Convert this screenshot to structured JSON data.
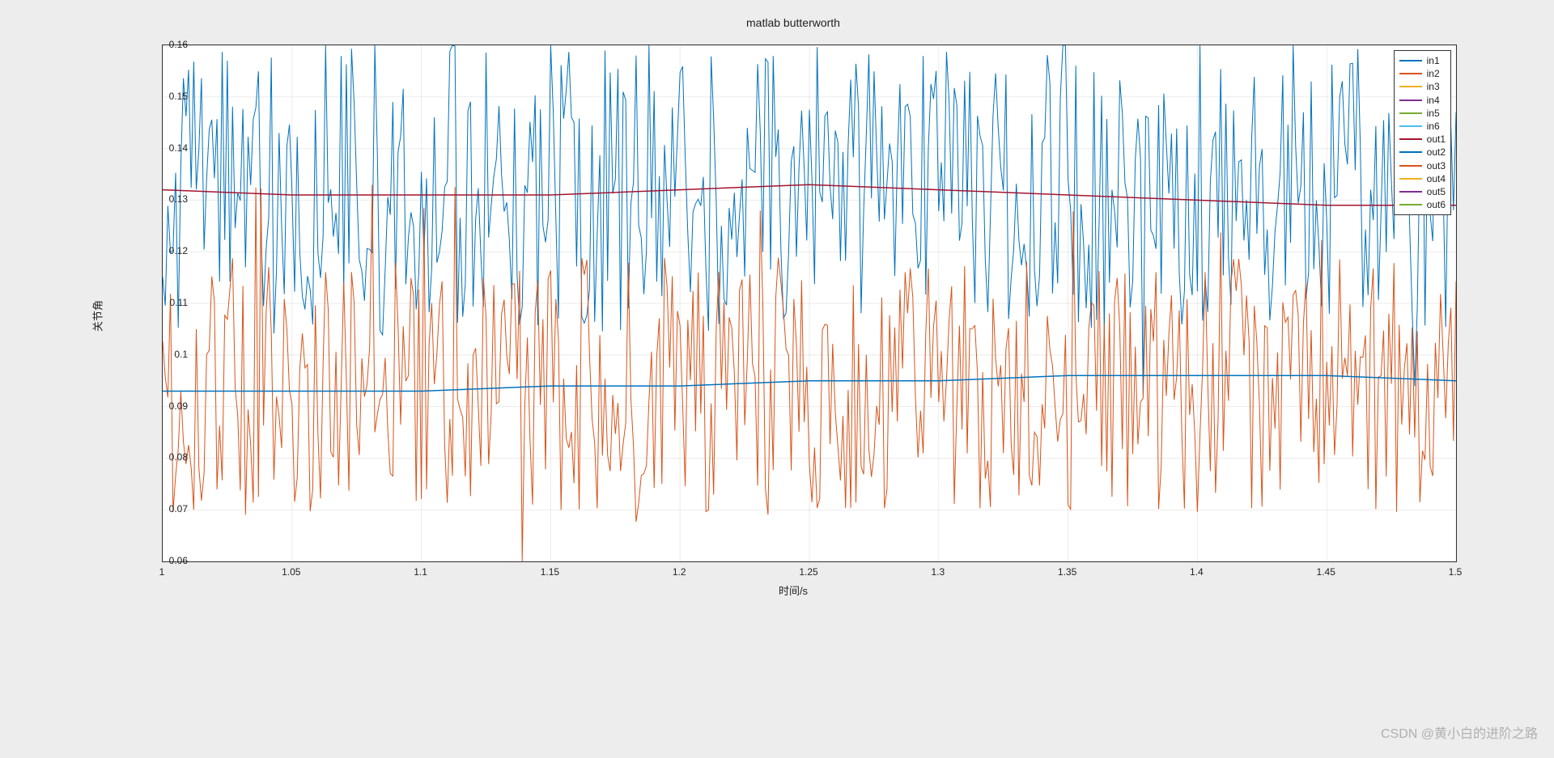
{
  "chart_data": {
    "type": "line",
    "title": "matlab butterworth",
    "xlabel": "时间/s",
    "ylabel": "关节角",
    "xlim": [
      1.0,
      1.5
    ],
    "ylim": [
      0.06,
      0.16
    ],
    "xticks": [
      1,
      1.05,
      1.1,
      1.15,
      1.2,
      1.25,
      1.3,
      1.35,
      1.4,
      1.45,
      1.5
    ],
    "yticks": [
      0.06,
      0.07,
      0.08,
      0.09,
      0.1,
      0.11,
      0.12,
      0.13,
      0.14,
      0.15,
      0.16
    ],
    "legend_position": "top-right",
    "series": [
      {
        "name": "in1",
        "color": "#0072BD",
        "kind": "noisy",
        "mean": 0.132,
        "band": 0.028,
        "note": "noisy input signal (blue)"
      },
      {
        "name": "in2",
        "color": "#D95319",
        "kind": "noisy",
        "mean": 0.094,
        "band": 0.025,
        "note": "noisy input signal (orange)"
      },
      {
        "name": "in3",
        "color": "#EDB120",
        "kind": "hidden-behind",
        "note": "obscured"
      },
      {
        "name": "in4",
        "color": "#7E2F8E",
        "kind": "hidden-behind",
        "note": "obscured"
      },
      {
        "name": "in5",
        "color": "#77AC30",
        "kind": "hidden-behind",
        "note": "obscured"
      },
      {
        "name": "in6",
        "color": "#4DBEEE",
        "kind": "hidden-behind",
        "note": "obscured"
      },
      {
        "name": "out1",
        "color": "#A2142F",
        "kind": "smooth",
        "values": [
          {
            "x": 1.0,
            "y": 0.132
          },
          {
            "x": 1.05,
            "y": 0.131
          },
          {
            "x": 1.1,
            "y": 0.131
          },
          {
            "x": 1.15,
            "y": 0.131
          },
          {
            "x": 1.2,
            "y": 0.132
          },
          {
            "x": 1.25,
            "y": 0.133
          },
          {
            "x": 1.3,
            "y": 0.132
          },
          {
            "x": 1.35,
            "y": 0.131
          },
          {
            "x": 1.4,
            "y": 0.13
          },
          {
            "x": 1.45,
            "y": 0.129
          },
          {
            "x": 1.5,
            "y": 0.129
          }
        ]
      },
      {
        "name": "out2",
        "color": "#0072BD",
        "kind": "smooth",
        "values": [
          {
            "x": 1.0,
            "y": 0.093
          },
          {
            "x": 1.05,
            "y": 0.093
          },
          {
            "x": 1.1,
            "y": 0.093
          },
          {
            "x": 1.15,
            "y": 0.094
          },
          {
            "x": 1.2,
            "y": 0.094
          },
          {
            "x": 1.25,
            "y": 0.095
          },
          {
            "x": 1.3,
            "y": 0.095
          },
          {
            "x": 1.35,
            "y": 0.096
          },
          {
            "x": 1.4,
            "y": 0.096
          },
          {
            "x": 1.45,
            "y": 0.096
          },
          {
            "x": 1.5,
            "y": 0.095
          }
        ]
      },
      {
        "name": "out3",
        "color": "#D95319",
        "kind": "hidden-behind"
      },
      {
        "name": "out4",
        "color": "#EDB120",
        "kind": "hidden-behind"
      },
      {
        "name": "out5",
        "color": "#7E2F8E",
        "kind": "hidden-behind"
      },
      {
        "name": "out6",
        "color": "#77AC30",
        "kind": "hidden-behind"
      }
    ],
    "legend": [
      "in1",
      "in2",
      "in3",
      "in4",
      "in5",
      "in6",
      "out1",
      "out2",
      "out3",
      "out4",
      "out5",
      "out6"
    ]
  },
  "watermark": "CSDN @黄小白的进阶之路"
}
